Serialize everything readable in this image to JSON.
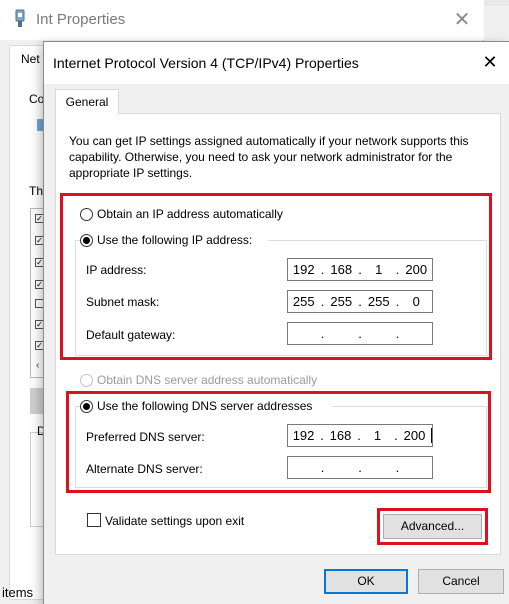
{
  "background_window": {
    "title": "Int Properties",
    "close_glyph": "✕",
    "tab_fragment": "Net",
    "label_co": "Co",
    "label_th": "Th",
    "label_d": "D",
    "footer_text": "items"
  },
  "dialog": {
    "title": "Internet Protocol Version 4 (TCP/IPv4) Properties",
    "close_glyph": "✕",
    "tab_general": "General",
    "intro": "You can get IP settings assigned automatically if your network supports this capability. Otherwise, you need to ask your network administrator for the appropriate IP settings.",
    "ip": {
      "auto_label": "Obtain an IP address automatically",
      "manual_label": "Use the following IP address:",
      "auto_selected": false,
      "manual_selected": true,
      "address_label": "IP address:",
      "address": [
        "192",
        "168",
        "1",
        "200"
      ],
      "subnet_label": "Subnet mask:",
      "subnet": [
        "255",
        "255",
        "255",
        "0"
      ],
      "gateway_label": "Default gateway:",
      "gateway": [
        "",
        "",
        "",
        ""
      ]
    },
    "dns": {
      "auto_label": "Obtain DNS server address automatically",
      "manual_label": "Use the following DNS server addresses",
      "auto_selected": false,
      "auto_disabled": true,
      "manual_selected": true,
      "preferred_label": "Preferred DNS server:",
      "preferred": [
        "192",
        "168",
        "1",
        "200"
      ],
      "alternate_label": "Alternate DNS server:",
      "alternate": [
        "",
        "",
        "",
        ""
      ]
    },
    "validate_label": "Validate settings upon exit",
    "validate_checked": false,
    "advanced_button": "Advanced...",
    "ok_button": "OK",
    "cancel_button": "Cancel"
  },
  "colors": {
    "highlight": "#d8121f",
    "ok_border": "#0078d7"
  },
  "icons": {
    "bg_title_icon": "network-adapter-icon"
  }
}
